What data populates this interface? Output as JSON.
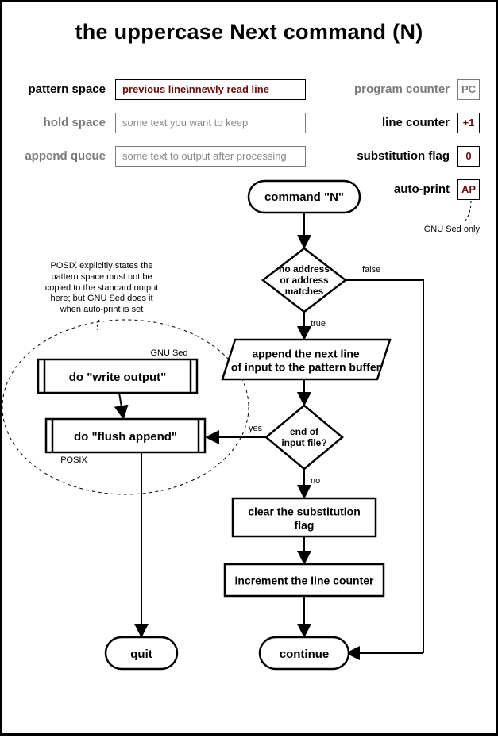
{
  "title": "the uppercase Next command (N)",
  "state": {
    "pattern_space": {
      "label": "pattern space",
      "value": "previous line\\nnewly read line"
    },
    "hold_space": {
      "label": "hold space",
      "value": "some text you want to keep"
    },
    "append_queue": {
      "label": "append queue",
      "value": "some text to output after processing"
    },
    "program_counter": {
      "label": "program counter",
      "value": "PC"
    },
    "line_counter": {
      "label": "line counter",
      "value": "+1"
    },
    "substitution_flag": {
      "label": "substitution flag",
      "value": "0"
    },
    "auto_print": {
      "label": "auto-print",
      "value": "AP"
    }
  },
  "notes": {
    "posix": [
      "POSIX explicitly states the",
      "pattern space must not be",
      "copied to the standard output",
      "here; but GNU Sed does it",
      "when auto-print is set"
    ],
    "gnu_only": "GNU Sed only"
  },
  "flow": {
    "start": "command \"N\"",
    "decision_address": [
      "no address",
      "or address",
      "matches"
    ],
    "io_append": [
      "append the next line",
      "of input to the pattern buffer"
    ],
    "decision_eof": [
      "end of",
      "input file?"
    ],
    "sub_write": "do \"write output\"",
    "sub_write_tag": "GNU Sed",
    "sub_flush": "do \"flush append\"",
    "sub_flush_tag": "POSIX",
    "clear_flag": [
      "clear the substitution",
      "flag"
    ],
    "increment": "increment the line counter",
    "quit": "quit",
    "continue": "continue",
    "labels": {
      "true": "true",
      "false": "false",
      "yes": "yes",
      "no": "no"
    }
  }
}
